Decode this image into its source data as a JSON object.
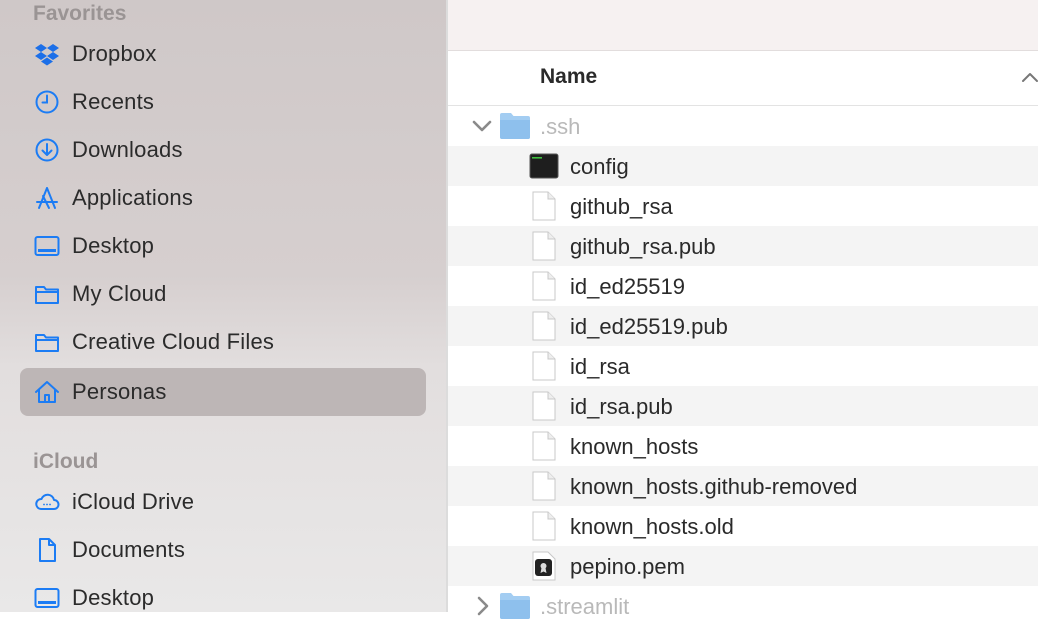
{
  "sidebar": {
    "favorites_title": "Favorites",
    "icloud_title": "iCloud",
    "items": [
      {
        "label": "Dropbox",
        "icon": "dropbox-icon"
      },
      {
        "label": "Recents",
        "icon": "clock-icon"
      },
      {
        "label": "Downloads",
        "icon": "download-icon"
      },
      {
        "label": "Applications",
        "icon": "applications-icon"
      },
      {
        "label": "Desktop",
        "icon": "desktop-icon"
      },
      {
        "label": "My Cloud",
        "icon": "folder-icon"
      },
      {
        "label": "Creative Cloud Files",
        "icon": "folder-icon"
      },
      {
        "label": "Personas",
        "icon": "home-icon",
        "selected": true
      }
    ],
    "icloud_items": [
      {
        "label": "iCloud Drive",
        "icon": "icloud-icon"
      },
      {
        "label": "Documents",
        "icon": "document-icon"
      },
      {
        "label": "Desktop",
        "icon": "desktop-icon"
      }
    ]
  },
  "header": {
    "name_label": "Name"
  },
  "files": [
    {
      "name": ".ssh",
      "type": "folder",
      "expanded": true
    },
    {
      "name": "config",
      "type": "terminal"
    },
    {
      "name": "github_rsa",
      "type": "file"
    },
    {
      "name": "github_rsa.pub",
      "type": "file"
    },
    {
      "name": "id_ed25519",
      "type": "file"
    },
    {
      "name": "id_ed25519.pub",
      "type": "file"
    },
    {
      "name": "id_rsa",
      "type": "file"
    },
    {
      "name": "id_rsa.pub",
      "type": "file"
    },
    {
      "name": "known_hosts",
      "type": "file"
    },
    {
      "name": "known_hosts.github-removed",
      "type": "file"
    },
    {
      "name": "known_hosts.old",
      "type": "file"
    },
    {
      "name": "pepino.pem",
      "type": "certificate"
    },
    {
      "name": ".streamlit",
      "type": "folder",
      "expanded": false
    }
  ],
  "colors": {
    "accent": "#1c7cf4",
    "selection": "#bdb6b6"
  }
}
